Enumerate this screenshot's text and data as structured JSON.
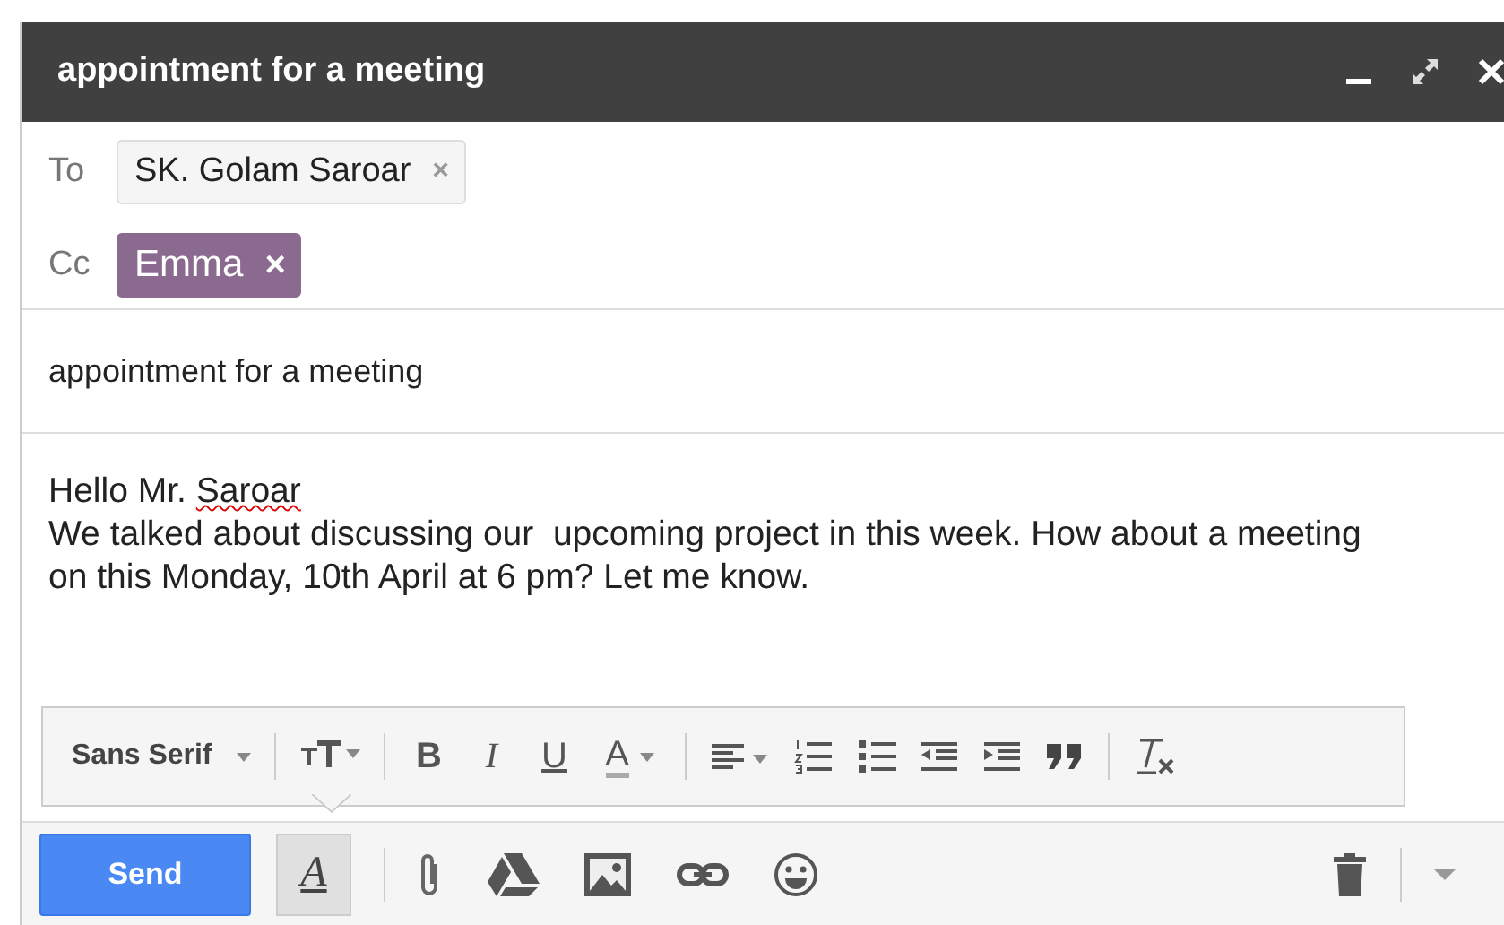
{
  "window": {
    "title": "appointment for a meeting"
  },
  "recipients": [
    {
      "label": "To",
      "chips": [
        {
          "name": "SK. Golam Saroar",
          "remove": "×",
          "selected": false
        }
      ]
    },
    {
      "label": "Cc",
      "chips": [
        {
          "name": "Emma",
          "remove": "×",
          "selected": true
        }
      ]
    }
  ],
  "subject": {
    "value": "appointment for a meeting"
  },
  "body": {
    "paragraphs": [
      [
        {
          "text": "Hello Mr. ",
          "misspelled": false
        },
        {
          "text": "Saroar",
          "misspelled": true
        }
      ],
      [
        {
          "text": "We talked about discussing our  upcoming project in this week. How about a meeting on this Monday, 10th April at 6 pm? Let me know.",
          "misspelled": false
        }
      ]
    ]
  },
  "format_toolbar": {
    "groups": [
      [
        {
          "kind": "dropdown",
          "label": "Sans Serif"
        }
      ],
      [
        {
          "kind": "size"
        }
      ],
      [
        {
          "kind": "bold",
          "label": "B"
        },
        {
          "kind": "italic",
          "label": "I"
        },
        {
          "kind": "underline",
          "label": "U"
        },
        {
          "kind": "color",
          "label": "A"
        }
      ],
      [
        {
          "kind": "align"
        },
        {
          "kind": "numbered-list"
        },
        {
          "kind": "bulleted-list"
        },
        {
          "kind": "indent-less"
        },
        {
          "kind": "indent-more"
        },
        {
          "kind": "quote"
        }
      ],
      [
        {
          "kind": "remove-format"
        }
      ]
    ]
  },
  "bottom_bar": {
    "send": "Send",
    "format_button": {
      "label": "A",
      "selected": true
    },
    "tools": [
      {
        "kind": "attach"
      },
      {
        "kind": "drive"
      },
      {
        "kind": "photo"
      },
      {
        "kind": "link"
      },
      {
        "kind": "emoji"
      }
    ]
  }
}
